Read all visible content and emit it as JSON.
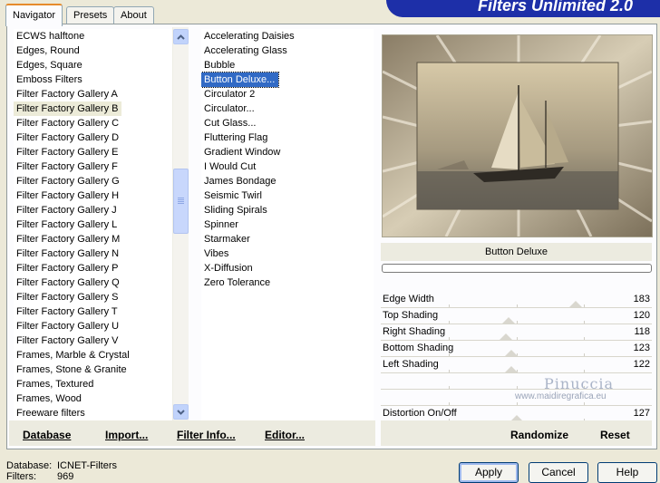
{
  "tabs": [
    {
      "label": "Navigator"
    },
    {
      "label": "Presets"
    },
    {
      "label": "About"
    }
  ],
  "banner": {
    "title": "Filters Unlimited 2.0"
  },
  "categories": [
    "ECWS halftone",
    "Edges, Round",
    "Edges, Square",
    "Emboss Filters",
    "Filter Factory Gallery A",
    "Filter Factory Gallery B",
    "Filter Factory Gallery C",
    "Filter Factory Gallery D",
    "Filter Factory Gallery E",
    "Filter Factory Gallery F",
    "Filter Factory Gallery G",
    "Filter Factory Gallery H",
    "Filter Factory Gallery J",
    "Filter Factory Gallery L",
    "Filter Factory Gallery M",
    "Filter Factory Gallery N",
    "Filter Factory Gallery P",
    "Filter Factory Gallery Q",
    "Filter Factory Gallery S",
    "Filter Factory Gallery T",
    "Filter Factory Gallery U",
    "Filter Factory Gallery V",
    "Frames, Marble & Crystal",
    "Frames, Stone & Granite",
    "Frames, Textured",
    "Frames, Wood",
    "Freeware filters"
  ],
  "selected_category": "Filter Factory Gallery B",
  "filters": [
    "Accelerating Daisies",
    "Accelerating Glass",
    "Bubble",
    "Button Deluxe...",
    "Circulator 2",
    "Circulator...",
    "Cut Glass...",
    "Fluttering Flag",
    "Gradient Window",
    "I Would Cut",
    "James Bondage",
    "Seismic Twirl",
    "Sliding Spirals",
    "Spinner",
    "Starmaker",
    "Vibes",
    "X-Diffusion",
    "Zero Tolerance"
  ],
  "selected_filter": "Button Deluxe...",
  "preview": {
    "filter_name": "Button Deluxe"
  },
  "sliders": [
    {
      "label": "Edge Width",
      "value": "183",
      "level": 0.72
    },
    {
      "label": "Top Shading",
      "value": "120",
      "level": 0.47
    },
    {
      "label": "Right Shading",
      "value": "118",
      "level": 0.46
    },
    {
      "label": "Bottom Shading",
      "value": "123",
      "level": 0.48
    },
    {
      "label": "Left Shading",
      "value": "122",
      "level": 0.48
    },
    {
      "label": "",
      "value": "",
      "level": null
    },
    {
      "label": "",
      "value": "",
      "level": null
    },
    {
      "label": "Distortion On/Off",
      "value": "127",
      "level": 0.5
    }
  ],
  "links": {
    "database": "Database",
    "import": "Import...",
    "filter_info": "Filter Info...",
    "editor": "Editor...",
    "randomize": "Randomize",
    "reset": "Reset"
  },
  "status": {
    "database_label": "Database:",
    "database_value": "ICNET-Filters",
    "filters_label": "Filters:",
    "filters_value": "969"
  },
  "buttons": {
    "apply": "Apply",
    "cancel": "Cancel",
    "help": "Help"
  },
  "watermark": {
    "line1": "Pinuccia",
    "line2": "www.maidiregrafica.eu"
  },
  "colors": {
    "selection": "#316ac5",
    "banner": "#1d2fa8",
    "tab_accent": "#e68b2c"
  }
}
